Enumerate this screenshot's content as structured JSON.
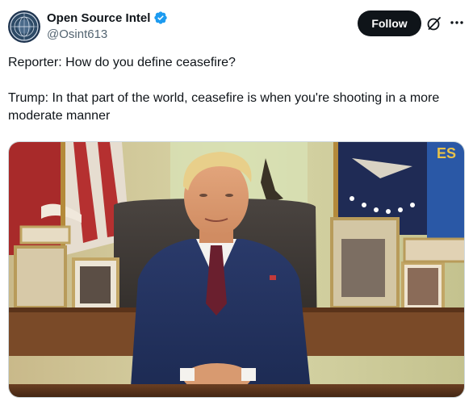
{
  "author": {
    "display_name": "Open Source Intel",
    "handle": "@Osint613",
    "verified": true,
    "avatar_icon": "globe-compass-avatar"
  },
  "actions": {
    "follow_label": "Follow",
    "grok_icon": "grok-icon",
    "more_icon": "more-icon"
  },
  "tweet": {
    "text": "Reporter: How do you define ceasefire?\n\nTrump: In that part of the world, ceasefire is when you're shooting in a more moderate manner"
  },
  "media": {
    "type": "video-still",
    "scene": "Man in navy suit and red tie seated at desk in office with flags and framed photos"
  },
  "colors": {
    "verified_blue": "#1d9bf0",
    "follow_bg": "#0f1419",
    "handle_gray": "#536471"
  }
}
